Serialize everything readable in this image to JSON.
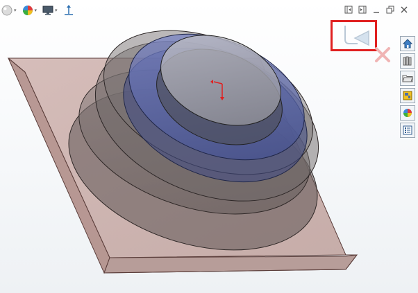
{
  "toolbar": {
    "items": [
      {
        "name": "appearance-sphere",
        "has_dropdown": true
      },
      {
        "name": "edit-appearance",
        "has_dropdown": true
      },
      {
        "name": "display-monitor",
        "has_dropdown": true
      },
      {
        "name": "view-orientation",
        "has_dropdown": false
      }
    ],
    "dropdown_glyph": "▾"
  },
  "window_controls": [
    "tile-left",
    "tile-right",
    "minimize",
    "restore",
    "close"
  ],
  "confirm_corner": {
    "ok_icon": "ok-checkmark-icon",
    "cancel_icon": "cancel-x-icon",
    "highlight_color": "#e02020"
  },
  "task_pane": {
    "tabs": [
      "home",
      "design-library",
      "file-explorer",
      "view-palette",
      "appearances",
      "custom-properties"
    ]
  },
  "colors": {
    "plate": "#b48c86",
    "body_dark": "#6f6664",
    "ring_blue": "#5b6aa8",
    "top_disc": "#9a9aa2",
    "triad": "#e02020"
  }
}
